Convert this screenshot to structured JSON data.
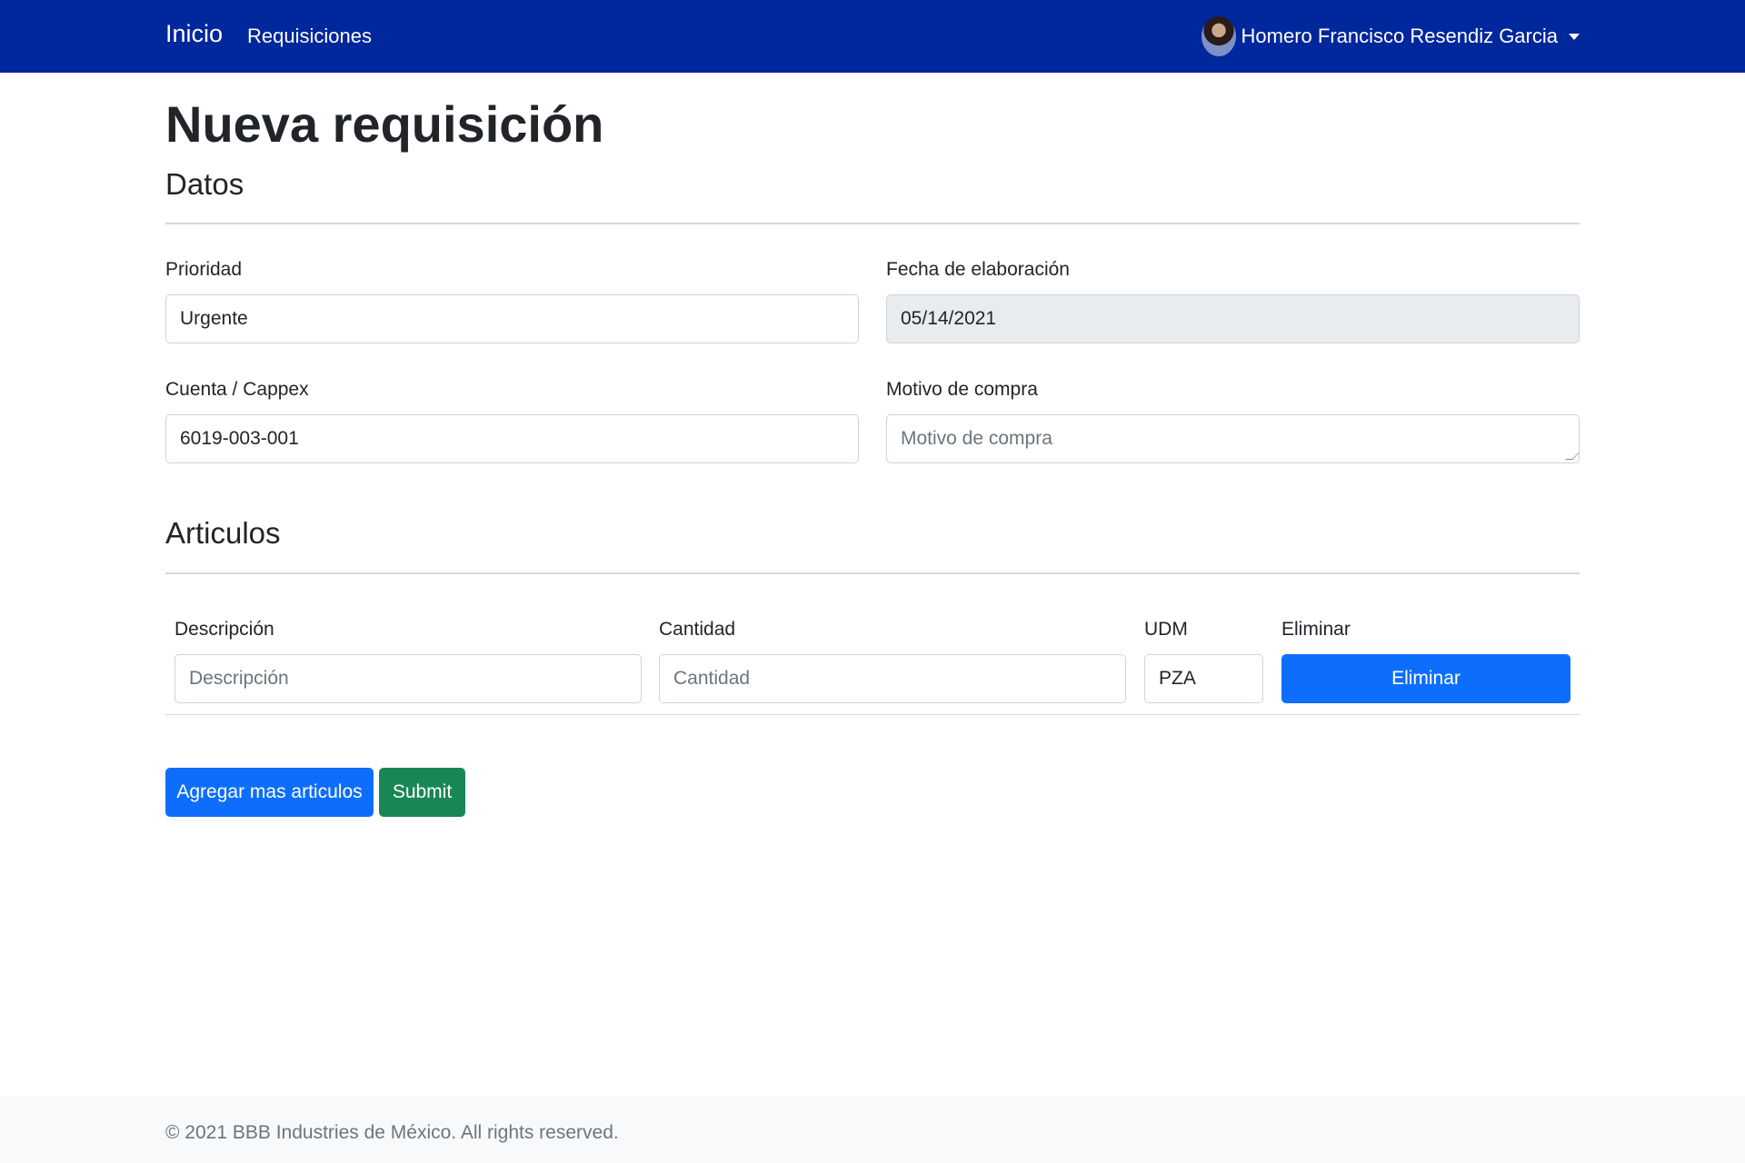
{
  "nav": {
    "brand": "Inicio",
    "links": [
      "Requisiciones"
    ],
    "user": "Homero Francisco Resendiz Garcia"
  },
  "page": {
    "title": "Nueva requisición"
  },
  "datos": {
    "heading": "Datos",
    "prioridad": {
      "label": "Prioridad",
      "value": "Urgente"
    },
    "fecha": {
      "label": "Fecha de elaboración",
      "value": "05/14/2021"
    },
    "cuenta": {
      "label": "Cuenta / Cappex",
      "value": "6019-003-001"
    },
    "motivo": {
      "label": "Motivo de compra",
      "value": "",
      "placeholder": "Motivo de compra"
    }
  },
  "articulos": {
    "heading": "Articulos",
    "columns": [
      "Descripción",
      "Cantidad",
      "UDM",
      "Eliminar"
    ],
    "rows": [
      {
        "descripcion_placeholder": "Descripción",
        "cantidad_placeholder": "Cantidad",
        "udm": "PZA",
        "delete_label": "Eliminar"
      }
    ]
  },
  "actions": {
    "add_label": "Agregar mas articulos",
    "submit_label": "Submit"
  },
  "footer": {
    "text": "© 2021 BBB Industries de México. All rights reserved."
  },
  "colors": {
    "navbar": "#00279b",
    "primary": "#0d6efd",
    "success": "#198754"
  }
}
